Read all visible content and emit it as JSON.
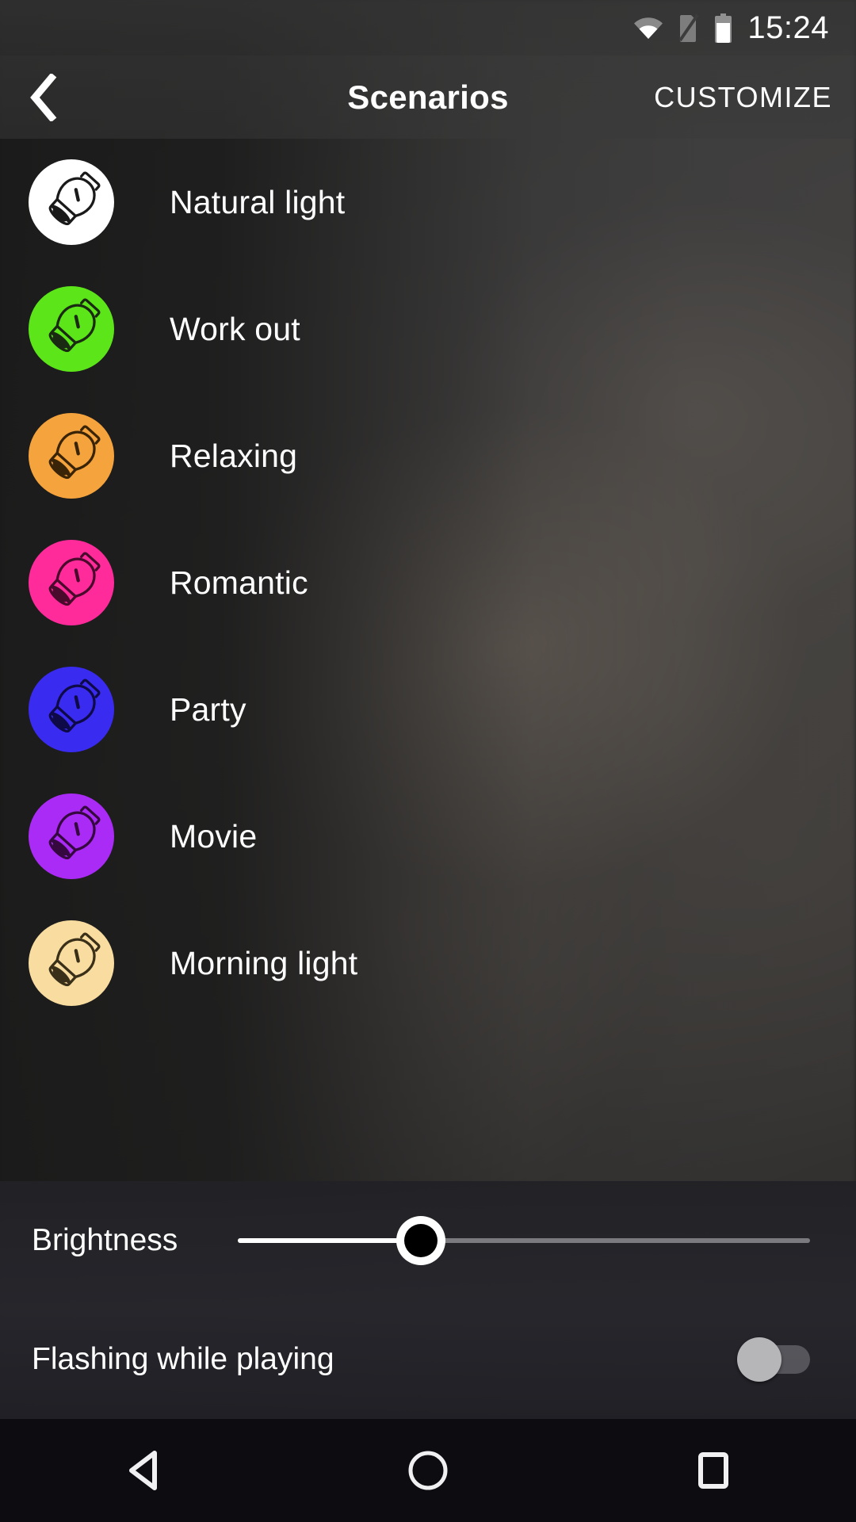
{
  "status_bar": {
    "time": "15:24",
    "icons": [
      "wifi-icon",
      "no-sim-icon",
      "battery-icon"
    ]
  },
  "app_bar": {
    "back_icon": "chevron-left-icon",
    "title": "Scenarios",
    "action_label": "CUSTOMIZE"
  },
  "scenarios": [
    {
      "label": "Natural light",
      "color": "#ffffff",
      "stroke": "#1a1a1a",
      "icon": "light-bulb-icon"
    },
    {
      "label": "Work out",
      "color": "#5ce619",
      "stroke": "#1a2a12",
      "icon": "light-bulb-icon"
    },
    {
      "label": "Relaxing",
      "color": "#f5a33c",
      "stroke": "#3a2408",
      "icon": "light-bulb-icon"
    },
    {
      "label": "Romantic",
      "color": "#ff2b9b",
      "stroke": "#4a0a2c",
      "icon": "light-bulb-icon"
    },
    {
      "label": "Party",
      "color": "#3a2bf0",
      "stroke": "#0e0a47",
      "icon": "light-bulb-icon"
    },
    {
      "label": "Movie",
      "color": "#aa2bf5",
      "stroke": "#35093f",
      "icon": "light-bulb-icon"
    },
    {
      "label": "Morning light",
      "color": "#f8dca0",
      "stroke": "#3a2f18",
      "icon": "light-bulb-icon"
    }
  ],
  "controls": {
    "brightness_label": "Brightness",
    "brightness_value": 32,
    "flashing_label": "Flashing while playing",
    "flashing_enabled": "off"
  },
  "nav_bar": {
    "back_icon": "triangle-back-icon",
    "home_icon": "circle-home-icon",
    "recents_icon": "square-recents-icon"
  },
  "colors": {
    "accent_white": "#ffffff",
    "panel_bg": "#232328",
    "nav_bg": "#0c0c11"
  }
}
